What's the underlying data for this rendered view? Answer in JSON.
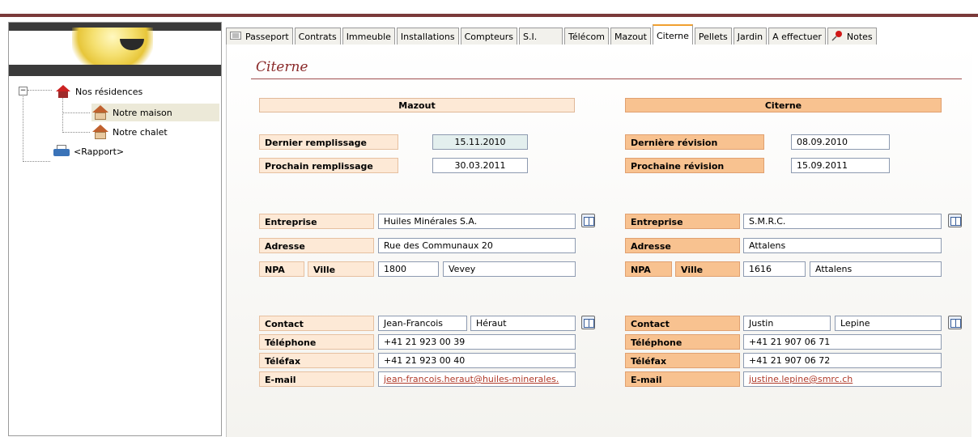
{
  "colors": {
    "accent_bar": "#7a3a3a",
    "title_color": "#8a2a2a",
    "left_section": "#fde9d6",
    "right_section": "#f8c290"
  },
  "tree": {
    "root": "Nos résidences",
    "children": [
      "Notre maison",
      "Notre chalet"
    ],
    "report": "<Rapport>",
    "expander": "−"
  },
  "tabs": [
    {
      "label": "Passeport",
      "icon": "passport-icon"
    },
    {
      "label": "Contrats"
    },
    {
      "label": "Immeuble"
    },
    {
      "label": "Installations"
    },
    {
      "label": "Compteurs"
    },
    {
      "label": "S.I."
    },
    {
      "label": "Télécom"
    },
    {
      "label": "Mazout"
    },
    {
      "label": "Citerne",
      "active": true
    },
    {
      "label": "Pellets"
    },
    {
      "label": "Jardin"
    },
    {
      "label": "A effectuer"
    },
    {
      "label": "Notes",
      "icon": "pin-icon"
    }
  ],
  "page_title": "Citerne",
  "mazout": {
    "header": "Mazout",
    "last_fill_label": "Dernier remplissage",
    "last_fill": "15.11.2010",
    "next_fill_label": "Prochain remplissage",
    "next_fill": "30.03.2011",
    "company_label": "Entreprise",
    "company": "Huiles Minérales S.A.",
    "address_label": "Adresse",
    "address": "Rue des Communaux 20",
    "npa_label": "NPA",
    "city_label": "Ville",
    "npa": "1800",
    "city": "Vevey",
    "contact_label": "Contact",
    "contact_first": "Jean-Francois",
    "contact_last": "Héraut",
    "phone_label": "Téléphone",
    "phone": "+41 21 923 00 39",
    "fax_label": "Téléfax",
    "fax": "+41 21 923 00 40",
    "email_label": "E-mail",
    "email": "jean-francois.heraut@huiles-minerales."
  },
  "citerne": {
    "header": "Citerne",
    "last_rev_label": "Dernière révision",
    "last_rev": "08.09.2010",
    "next_rev_label": "Prochaine révision",
    "next_rev": "15.09.2011",
    "company_label": "Entreprise",
    "company": "S.M.R.C.",
    "address_label": "Adresse",
    "address": "Attalens",
    "npa_label": "NPA",
    "city_label": "Ville",
    "npa": "1616",
    "city": "Attalens",
    "contact_label": "Contact",
    "contact_first": "Justin",
    "contact_last": "Lepine",
    "phone_label": "Téléphone",
    "phone": "+41 21 907 06 71",
    "fax_label": "Téléfax",
    "fax": "+41 21 907 06 72",
    "email_label": "E-mail",
    "email": "justine.lepine@smrc.ch"
  }
}
